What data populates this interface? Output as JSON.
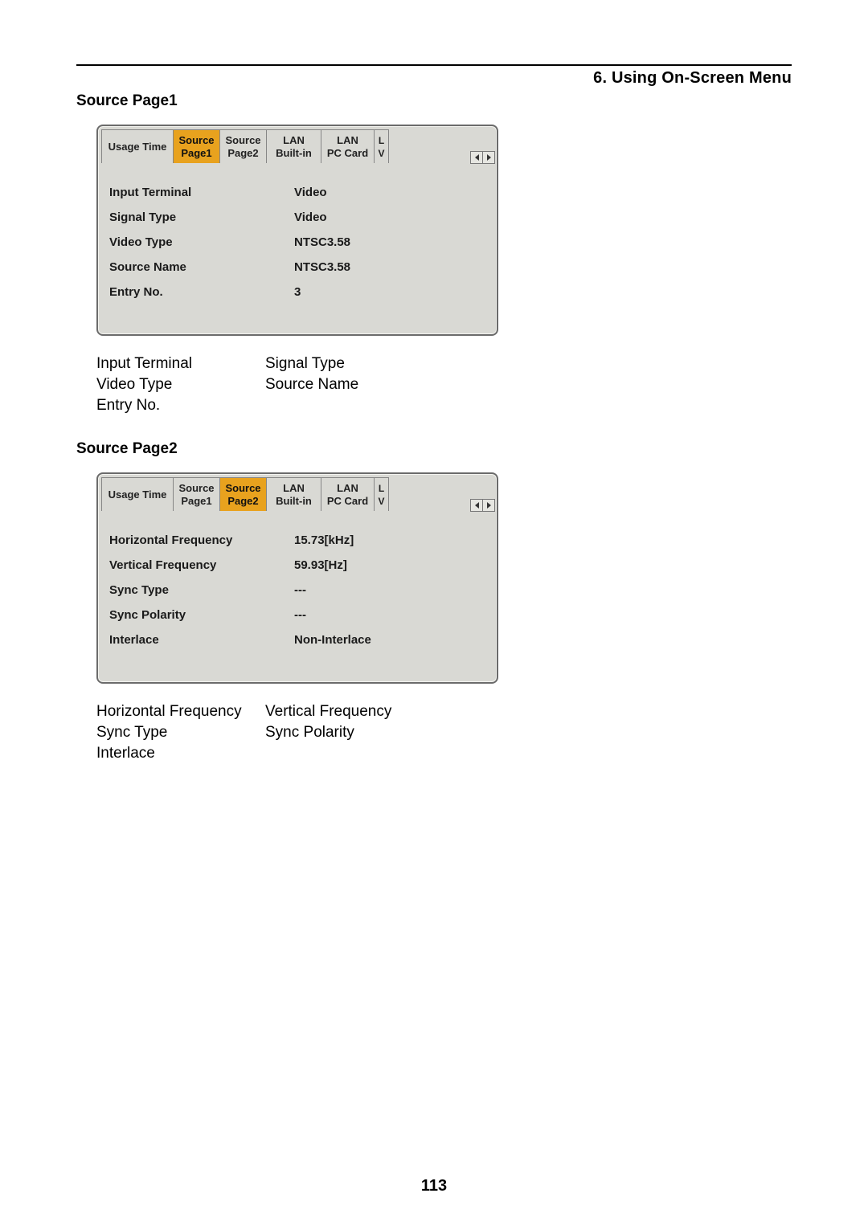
{
  "chapter_title": "6. Using On-Screen Menu",
  "page_number": "113",
  "section1": {
    "heading": "Source Page1",
    "tabs": {
      "t0": "Usage Time",
      "t1a": "Source",
      "t1b": "Page1",
      "t2a": "Source",
      "t2b": "Page2",
      "t3a": "LAN",
      "t3b": "Built-in",
      "t4a": "LAN",
      "t4b": "PC Card",
      "t5a": "L",
      "t5b": "V"
    },
    "rows": [
      {
        "label": "Input Terminal",
        "value": "Video"
      },
      {
        "label": "Signal Type",
        "value": "Video"
      },
      {
        "label": "Video Type",
        "value": "NTSC3.58"
      },
      {
        "label": "Source Name",
        "value": "NTSC3.58"
      },
      {
        "label": "Entry No.",
        "value": "3"
      }
    ],
    "terms": [
      [
        "Input Terminal",
        "Signal Type"
      ],
      [
        "Video Type",
        "Source Name"
      ],
      [
        "Entry No.",
        ""
      ]
    ]
  },
  "section2": {
    "heading": "Source Page2",
    "tabs": {
      "t0": "Usage Time",
      "t1a": "Source",
      "t1b": "Page1",
      "t2a": "Source",
      "t2b": "Page2",
      "t3a": "LAN",
      "t3b": "Built-in",
      "t4a": "LAN",
      "t4b": "PC Card",
      "t5a": "L",
      "t5b": "V"
    },
    "rows": [
      {
        "label": "Horizontal Frequency",
        "value": "15.73[kHz]"
      },
      {
        "label": "Vertical Frequency",
        "value": "59.93[Hz]"
      },
      {
        "label": "Sync Type",
        "value": "---"
      },
      {
        "label": "Sync Polarity",
        "value": "---"
      },
      {
        "label": "Interlace",
        "value": "Non-Interlace"
      }
    ],
    "terms": [
      [
        "Horizontal Frequency",
        "Vertical Frequency"
      ],
      [
        "Sync Type",
        "Sync Polarity"
      ],
      [
        "Interlace",
        ""
      ]
    ]
  }
}
